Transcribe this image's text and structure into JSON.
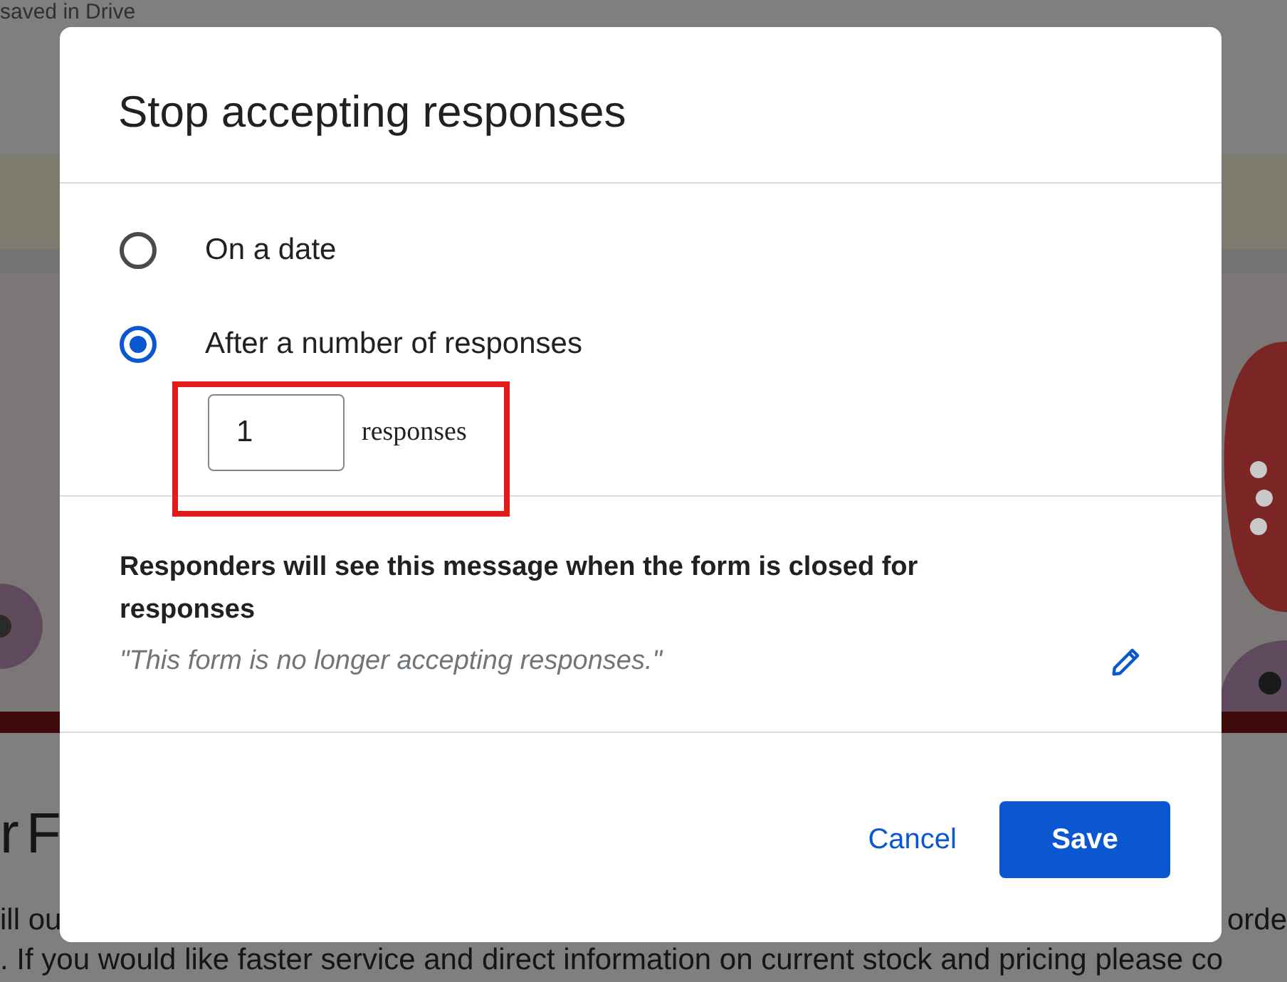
{
  "background": {
    "status": "saved in Drive",
    "heading": "r F",
    "text_lines": [
      "ill ou",
      "orde",
      ". If you would like faster service and direct information on current stock and pricing please co"
    ]
  },
  "dialog": {
    "title": "Stop accepting responses",
    "options": [
      {
        "label": "On a date",
        "selected": false
      },
      {
        "label": "After a number of responses",
        "selected": true
      }
    ],
    "response_limit": {
      "value": "1",
      "unit": "responses"
    },
    "message": {
      "heading": "Responders will see this message when the form is closed for responses",
      "text": "\"This form is no longer accepting responses.\""
    },
    "buttons": [
      {
        "label": "Cancel",
        "kind": "text"
      },
      {
        "label": "Save",
        "kind": "filled"
      }
    ]
  }
}
